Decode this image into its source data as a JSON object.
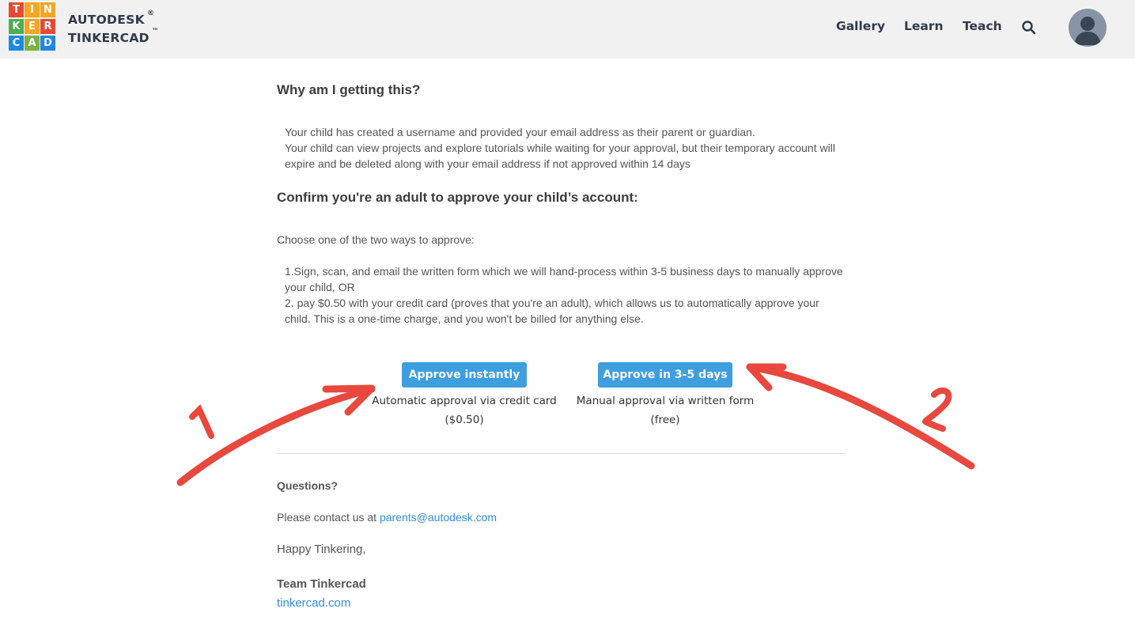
{
  "header": {
    "logo_letters": [
      "T",
      "I",
      "N",
      "K",
      "E",
      "R",
      "C",
      "A",
      "D"
    ],
    "logo_colors": [
      "#e64b32",
      "#f5a623",
      "#f5a623",
      "#4caf50",
      "#f5a623",
      "#e64b32",
      "#1e88e5",
      "#7cb342",
      "#1e88e5"
    ],
    "brand_line1": "AUTODESK",
    "brand_reg": "®",
    "brand_line2": "TINKERCAD",
    "brand_tm": "™",
    "nav": [
      "Gallery",
      "Learn",
      "Teach"
    ],
    "search_icon": "search-icon",
    "avatar_icon": "user-avatar"
  },
  "why": {
    "title": "Why am I getting this?",
    "line1": "Your child has created a username and provided your email address as their parent or guardian.",
    "line2": "Your child can view projects and explore tutorials while waiting for your approval, but their temporary account will",
    "line3": "expire and be deleted along with your email address if not approved within 14 days"
  },
  "confirm": {
    "title": "Confirm you're an adult to approve your child’s account:",
    "intro": "Choose one of the two ways to approve:",
    "opt1_a": "1.Sign, scan, and email the written form which we will hand-process within 3-5 business days to manually approve",
    "opt1_b": "your child, OR",
    "opt2_a": "2. pay $0.50 with your credit card (proves that you're an adult), which allows us to automatically approve your",
    "opt2_b": "child. This is a one-time charge, and you won't be billed for anything else."
  },
  "actions": {
    "instant_label": "Approve instantly",
    "instant_caption1": "Automatic approval via credit card",
    "instant_caption2": "($0.50)",
    "manual_label": "Approve in 3-5 days",
    "manual_caption1": "Manual approval via written form",
    "manual_caption2": "(free)"
  },
  "footer": {
    "questions": "Questions?",
    "contact_prefix": "Please contact us at ",
    "contact_email": "parents@autodesk.com",
    "sign_off": "Happy Tinkering,",
    "team": "Team Tinkercad",
    "site": "tinkercad.com"
  },
  "annotations": {
    "arrow_color": "#e8483e",
    "label1": "1",
    "label2": "2"
  },
  "colors": {
    "button": "#3d9ee0",
    "link": "#2f8fdd",
    "header_bg": "#f1f1f2"
  }
}
